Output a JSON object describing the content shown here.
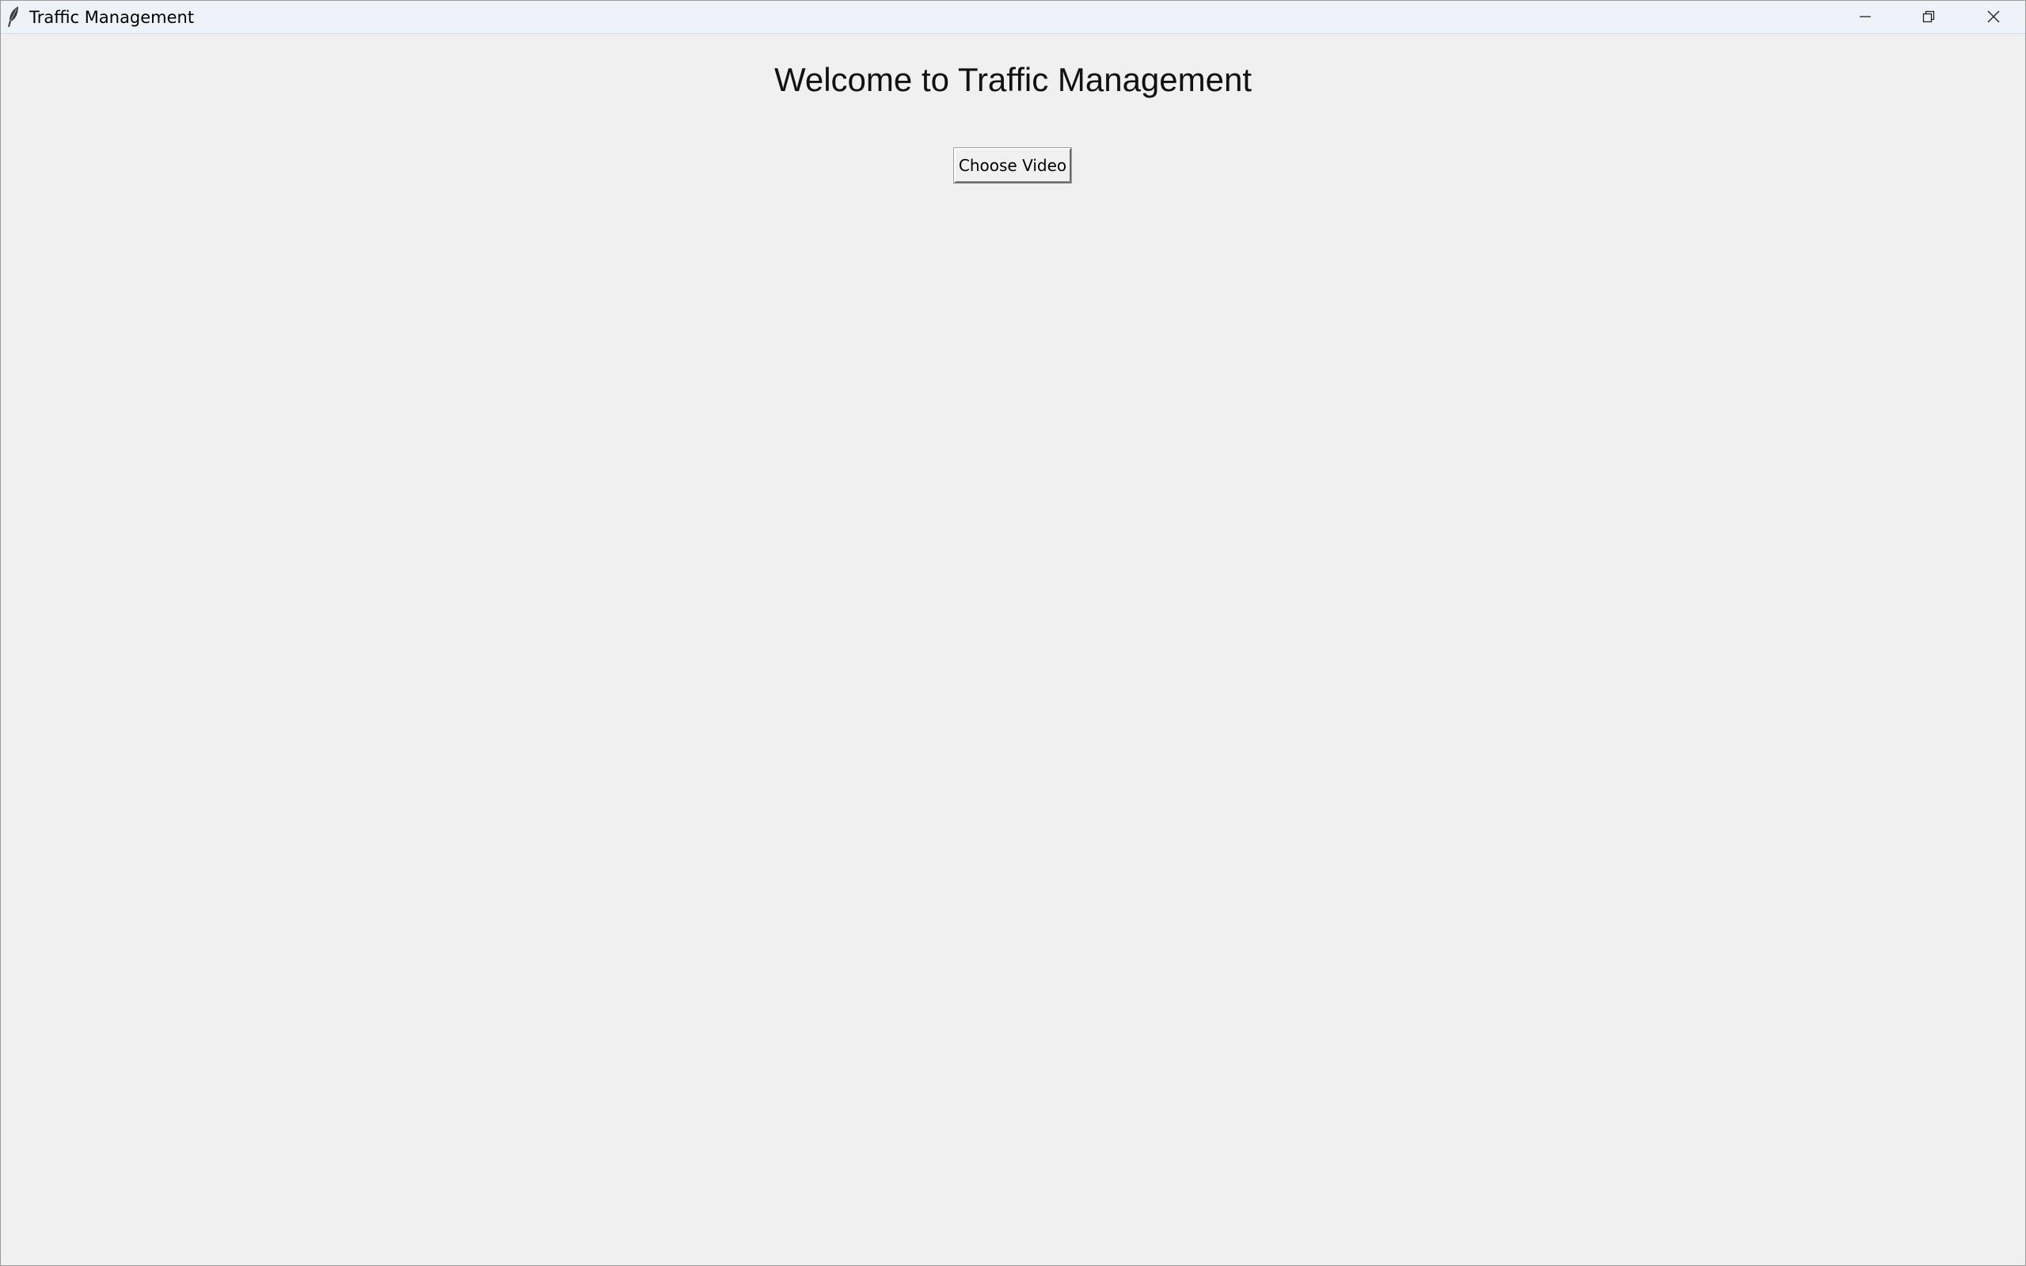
{
  "window": {
    "title": "Traffic Management",
    "app_icon": "feather-icon",
    "controls": {
      "minimize_icon": "minimize-icon",
      "restore_icon": "restore-icon",
      "close_icon": "close-icon"
    }
  },
  "main": {
    "heading": "Welcome to Traffic Management",
    "choose_video_label": "Choose Video"
  },
  "colors": {
    "background": "#f0f0f0",
    "titlebar": "#eef3fa",
    "text": "#111111"
  }
}
